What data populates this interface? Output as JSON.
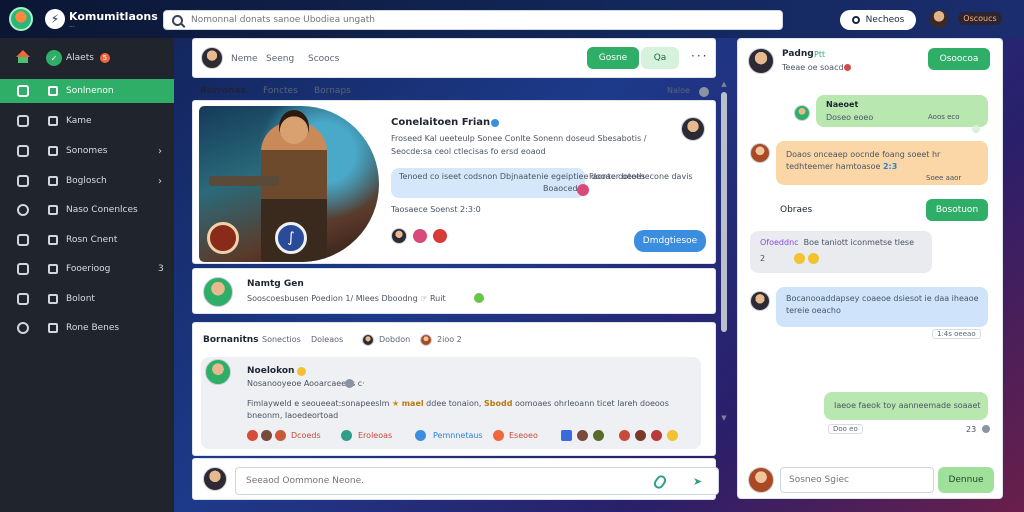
{
  "topbar": {
    "brand_name": "Komumitlaons",
    "brand_icon": "lightning",
    "brand_sub": "···",
    "search_placeholder": "Nomonnal donats sanoe Ubodiea ungath",
    "search_button": "Necheos",
    "badge": "Oscoucs"
  },
  "sidebar": {
    "items": [
      {
        "label": "Alaets",
        "badge": "5"
      },
      {
        "label": "Sonlnenon"
      },
      {
        "label": "Kame"
      },
      {
        "label": "Sonomes",
        "chevron": "›"
      },
      {
        "label": "Boglosch",
        "chevron": "›"
      },
      {
        "label": "Naso Conenlces"
      },
      {
        "label": "Rosn Cnent"
      },
      {
        "label": "Fooerioog",
        "count": "3"
      },
      {
        "label": "Bolont"
      },
      {
        "label": "Rone Benes"
      }
    ]
  },
  "post_header": {
    "tabs": [
      "Neme",
      "Seeng",
      "Scoocs"
    ],
    "primary_button": "Gosne",
    "secondary_button": "Qa",
    "more": "···"
  },
  "feed": {
    "tabs": [
      "Borronas",
      "Fonctes",
      "Bornaps"
    ],
    "filter": "Naloe"
  },
  "feature_post": {
    "title": "Conelaitoen Frian",
    "line1": "Froseed Kal ueeteulp Sonee  Conlte Sonenn doseud  Sbesabotis  /",
    "line2": "Seocde:sa ceol ctlecisas fo ersd eoaod",
    "bubble": "Tenoed co iseet codsnon Dbjnaatenie egeiptiee dooae ootees",
    "bubble_tag": "Boaoced",
    "side_text": "Faonter beothecone davis",
    "meta": "Taosaece  Soenst  2:3:0",
    "action": "Dmdgtiesoe"
  },
  "user_row": {
    "name": "Namtg Gen",
    "line": "Sooscoesbusen  Poedion  1/ Mlees  Dboodng  ☞  Ruit"
  },
  "comments": {
    "tabs": [
      "Bornanitns",
      "Sonectios",
      "Doleaos"
    ],
    "chip1": "Dobdon",
    "chip2": "2ioo 2",
    "author": "Noelokon",
    "sub": "Nosanooyeoe  Aooarcaeees  c·",
    "body_start": "Fimlayweld e seoueeat:sonapeeslm",
    "body_tag1": "mael",
    "body_mid": "ddee tonaion,",
    "body_tag2": "Sbodd",
    "body_end": "oomoaes ohrleoann ticet lareh doeoos",
    "body_line2": "bneonm, Iaoedeortoad",
    "react1": "Dcoeds",
    "react2": "Eroleoas",
    "react3": "Pemnnetaus",
    "react4": "Eseoeo"
  },
  "comment_input": {
    "placeholder": "Seeaod Oommone Neone."
  },
  "chat": {
    "name": "Padng",
    "name_tag": "Ptt",
    "sub": "Teeae oe soacd",
    "header_button": "Osoocoa",
    "messages": [
      {
        "title": "Naeoet",
        "text": "Doseo eoeo",
        "time": "Aoos eco"
      },
      {
        "text": "Doaos onceaep oocnde foang soeet hr tedhteemer hamtoasoe",
        "tag": "2:3",
        "time": "Soee aaor"
      },
      {
        "text": "Ofoeddnc"
      },
      {
        "text": "Boe taniott  iconmetse tlese",
        "tag": "2"
      },
      {
        "text": "Bocanooaddapsey coaeoe dsiesot ie daa iheaoe tereie oeacho",
        "time": "1:4s oeeao"
      },
      {
        "text": "Iaeoe faeok toy aanneemade soaaet",
        "time": "Doo eo",
        "time2": "23"
      }
    ],
    "section_label": "Obraes",
    "section_button": "Bosotuon",
    "input_placeholder": "Sosneo Sgiec",
    "send_button": "Dennue"
  }
}
